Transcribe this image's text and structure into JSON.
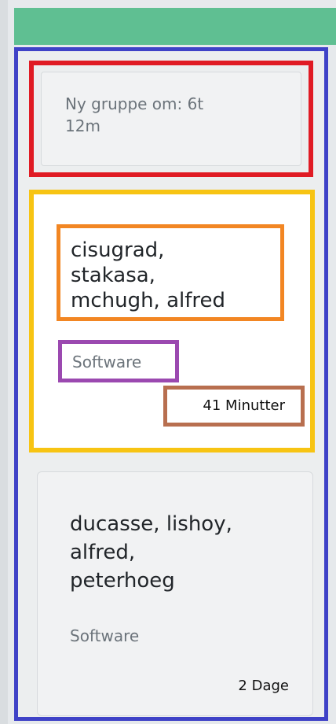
{
  "notice": {
    "text_line1": "Ny gruppe om: 6t",
    "text_line2": "12m"
  },
  "groups": [
    {
      "names_line1": "cisugrad,",
      "names_line2": "stakasa,",
      "names_line3": "mchugh, alfred",
      "category": "Software",
      "time_ago": "41 Minutter"
    },
    {
      "names_line1": "ducasse, lishoy,",
      "names_line2": "alfred,",
      "names_line3": "peterhoeg",
      "category": "Software",
      "time_ago": "2 Dage"
    }
  ],
  "colors": {
    "top_bar": "#5fbf92",
    "panel_outline": "#3f42c7",
    "notice_outline": "#e01b24",
    "card_outline": "#f7c413",
    "names_outline": "#f28623",
    "category_outline": "#9b49b0",
    "time_outline": "#b86f4f"
  }
}
